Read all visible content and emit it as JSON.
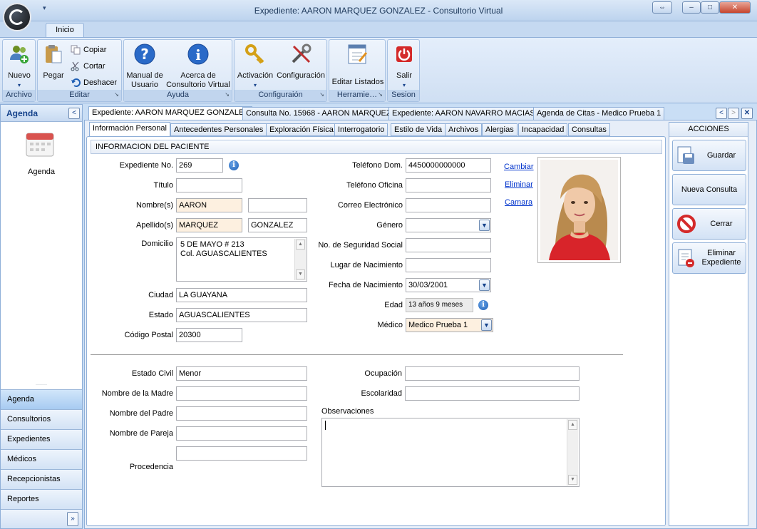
{
  "window": {
    "title": "Expediente: AARON MARQUEZ GONZALEZ - Consultorio Virtual",
    "qat_arrow": "▾",
    "buttons": {
      "restore": "⇔",
      "minimize": "–",
      "maximize": "□",
      "close": "✕"
    }
  },
  "ribbon": {
    "tab": "Inicio",
    "groups": {
      "archivo": {
        "label": "Archivo",
        "nuevo": "Nuevo"
      },
      "editar": {
        "label": "Editar",
        "pegar": "Pegar",
        "copiar": "Copiar",
        "cortar": "Cortar",
        "deshacer": "Deshacer"
      },
      "ayuda": {
        "label": "Ayuda",
        "manual_1": "Manual de",
        "manual_2": "Usuario",
        "acerca_1": "Acerca de",
        "acerca_2": "Consultorio Virtual"
      },
      "config": {
        "label": "Configuraión",
        "activacion": "Activación",
        "configuracion": "Configuración"
      },
      "herramientas": {
        "label": "Herramie…",
        "editar_listados": "Editar Listados"
      },
      "sesion": {
        "label": "Sesion",
        "salir": "Salir"
      }
    }
  },
  "left_pane": {
    "title": "Agenda",
    "collapse": "<",
    "big_item": "Agenda",
    "nav": [
      "Agenda",
      "Consultorios",
      "Expedientes",
      "Médicos",
      "Recepcionistas",
      "Reportes"
    ],
    "more": "»"
  },
  "doc_tabs": [
    "Expediente: AARON MARQUEZ GONZALEZ",
    "Consulta No. 15968 - AARON MARQUEZ",
    "Expediente: AARON NAVARRO MACIAS",
    "Agenda de Citas - Medico Prueba 1"
  ],
  "doc_tab_nav": {
    "prev": "<",
    "next": ">",
    "close": "✕"
  },
  "sub_tabs": [
    "Información Personal",
    "Antecedentes Personales",
    "Exploración Física",
    "Interrogatorio",
    "Estilo de Vida",
    "Archivos",
    "Alergias",
    "Incapacidad",
    "Consultas"
  ],
  "section_title": "INFORMACION DEL PACIENTE",
  "left_fields": {
    "expediente_label": "Expediente No.",
    "expediente": "269",
    "titulo_label": "Título",
    "titulo": "",
    "nombre_label": "Nombre(s)",
    "nombre1": "AARON",
    "nombre2": "",
    "apellido_label": "Apellido(s)",
    "apellido1": "MARQUEZ",
    "apellido2": "GONZALEZ",
    "domicilio_label": "Domicilio",
    "domicilio_1": "5 DE MAYO # 213",
    "domicilio_2": "Col. AGUASCALIENTES",
    "ciudad_label": "Ciudad",
    "ciudad": "LA GUAYANA",
    "estado_label": "Estado",
    "estado": "AGUASCALIENTES",
    "cp_label": "Código Postal",
    "cp": "20300"
  },
  "right_fields": {
    "tel_dom_label": "Teléfono Dom.",
    "tel_dom": "4450000000000",
    "tel_ofi_label": "Teléfono Oficina",
    "tel_ofi": "",
    "correo_label": "Correo Electrónico",
    "correo": "",
    "genero_label": "Género",
    "genero": "",
    "nss_label": "No. de Seguridad Social",
    "nss": "",
    "lugar_label": "Lugar de Nacimiento",
    "lugar": "",
    "fecha_label": "Fecha de Nacimiento",
    "fecha": "30/03/2001",
    "edad_label": "Edad",
    "edad": "13 años 9 meses",
    "medico_label": "Médico",
    "medico": "Medico Prueba 1"
  },
  "photo_links": {
    "cambiar": "Cambiar",
    "eliminar": "Eliminar",
    "camara": "Camara"
  },
  "bottom_fields": {
    "estado_civil_label": "Estado Civil",
    "estado_civil": "Menor",
    "madre_label": "Nombre de la Madre",
    "madre": "",
    "padre_label": "Nombre del Padre",
    "padre": "",
    "pareja_label": "Nombre de Pareja",
    "pareja": "",
    "procedencia_label": "Procedencia",
    "procedencia": "",
    "ocupacion_label": "Ocupación",
    "ocupacion": "",
    "escolaridad_label": "Escolaridad",
    "escolaridad": "",
    "observaciones_label": "Observaciones",
    "observaciones": ""
  },
  "actions": {
    "title": "ACCIONES",
    "guardar": "Guardar",
    "nueva_consulta": "Nueva Consulta",
    "cerrar": "Cerrar",
    "eliminar_1": "Eliminar",
    "eliminar_2": "Expediente"
  },
  "colors": {
    "accent": "#15428b",
    "ribbon_bg": "#dbe8f7",
    "required_bg": "#fdf0e0",
    "link": "#0033cc"
  }
}
